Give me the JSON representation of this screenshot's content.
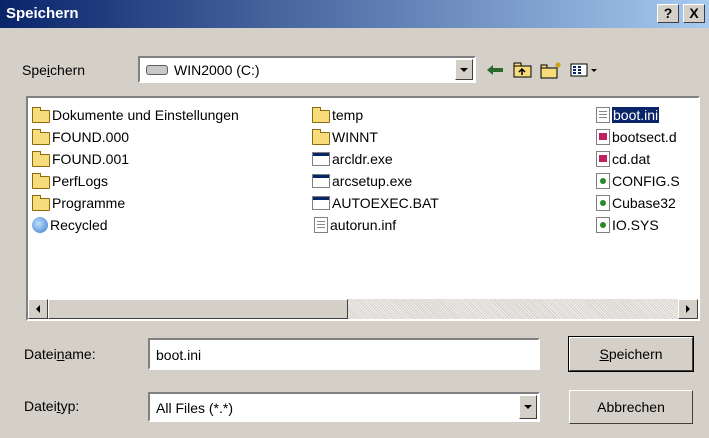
{
  "window": {
    "title": "Speichern",
    "help_label": "?",
    "close_label": "X"
  },
  "lookin": {
    "label_pre": "Spe",
    "label_u": "i",
    "label_post": "chern",
    "value": "WIN2000 (C:)"
  },
  "toolbar": {
    "icons": [
      "back-arrow-icon",
      "up-folder-icon",
      "new-folder-icon",
      "view-menu-icon"
    ]
  },
  "files": {
    "col1": [
      {
        "name": "Dokumente und Einstellungen",
        "icon": "folder"
      },
      {
        "name": "FOUND.000",
        "icon": "folder"
      },
      {
        "name": "FOUND.001",
        "icon": "folder"
      },
      {
        "name": "PerfLogs",
        "icon": "folder"
      },
      {
        "name": "Programme",
        "icon": "folder"
      },
      {
        "name": "Recycled",
        "icon": "recycle"
      }
    ],
    "col2": [
      {
        "name": "temp",
        "icon": "folder"
      },
      {
        "name": "WINNT",
        "icon": "folder"
      },
      {
        "name": "arcldr.exe",
        "icon": "exe"
      },
      {
        "name": "arcsetup.exe",
        "icon": "exe"
      },
      {
        "name": "AUTOEXEC.BAT",
        "icon": "exe"
      },
      {
        "name": "autorun.inf",
        "icon": "doc"
      }
    ],
    "col3": [
      {
        "name": "boot.ini",
        "icon": "doc",
        "selected": true
      },
      {
        "name": "bootsect.d",
        "icon": "img"
      },
      {
        "name": "cd.dat",
        "icon": "img"
      },
      {
        "name": "CONFIG.S",
        "icon": "sys"
      },
      {
        "name": "Cubase32",
        "icon": "sys"
      },
      {
        "name": "IO.SYS",
        "icon": "sys"
      }
    ]
  },
  "filename": {
    "label_pre": "Datei",
    "label_u": "n",
    "label_post": "ame:",
    "value": "boot.ini"
  },
  "filetype": {
    "label_pre": "Datei",
    "label_u": "t",
    "label_post": "yp:",
    "value": "All Files (*.*)"
  },
  "buttons": {
    "save_u": "S",
    "save_rest": "peichern",
    "cancel": "Abbrechen"
  }
}
